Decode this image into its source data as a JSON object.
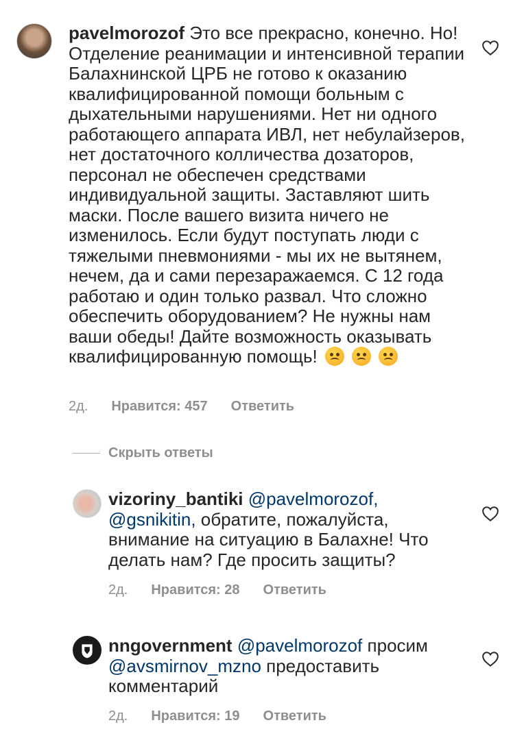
{
  "comments": [
    {
      "username": "pavelmorozof",
      "text": "Это все прекрасно, конечно. Но! Отделение реанимации и интенсивной терапии Балахнинской ЦРБ не готово к оказанию квалифицированной помощи больным с дыхательными нарушениями. Нет ни одного работающего аппарата ИВЛ, нет небулайзеров, нет достаточного колличества дозаторов, персонал не обеспечен средствами индивидуальной защиты. Заставляют шить маски. После вашего визита ничего не изменилось. Если будут поступать люди с тяжелыми пневмониями - мы их не вытянем, нечем, да и сами перезаражаемся. С 12 года работаю и один только развал. Что сложно обеспечить оборудованием?  Не нужны нам ваши обеды! Дайте возможность оказывать квалифицированную помощь!",
      "emojis": [
        "angry-face",
        "angry-face",
        "angry-face"
      ],
      "age": "2д.",
      "likes": "Нравится: 457",
      "reply": "Ответить"
    },
    {
      "username": "vizoriny_bantiki",
      "mention1": "@pavelmorozof,",
      "mention2": "@gsnikitin,",
      "text": "обратите, пожалуйста, внимание на ситуацию в Балахне! Что делать нам? Где просить защиты?",
      "age": "2д.",
      "likes": "Нравится: 28",
      "reply": "Ответить"
    },
    {
      "username": "nngovernment",
      "mention1": "@pavelmorozof",
      "text1": "просим",
      "mention2": "@avsmirnov_mzno",
      "text2": "предоставить комментарий",
      "age": "2д.",
      "likes": "Нравится: 19",
      "reply": "Ответить"
    }
  ],
  "hide_replies": "Скрыть ответы",
  "colors": {
    "text": "#262626",
    "meta": "#8e8e8e",
    "mention": "#00376b"
  }
}
